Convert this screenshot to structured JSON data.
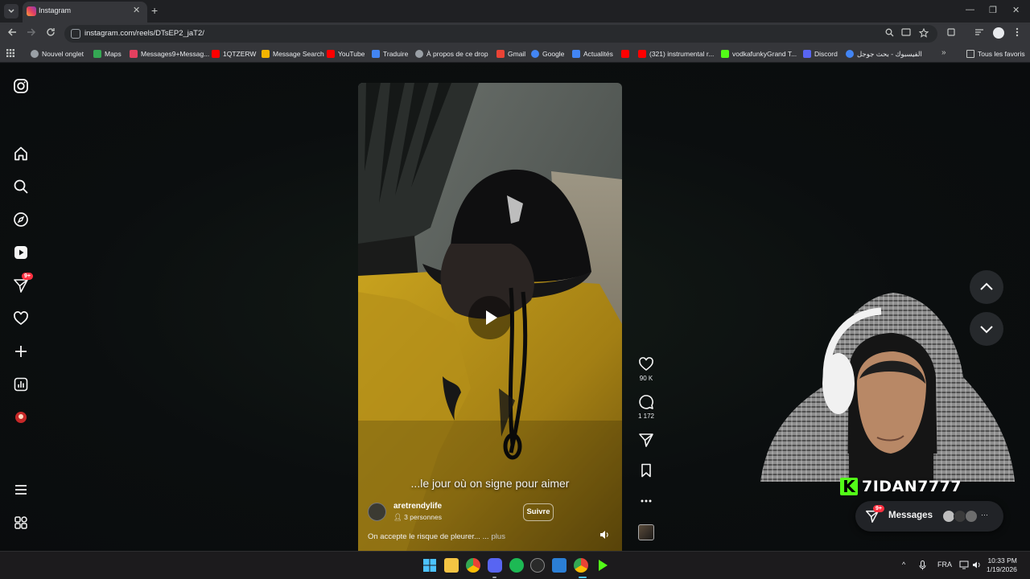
{
  "browser": {
    "tab_title": "Instagram",
    "tab_close": "✕",
    "new_tab": "+",
    "url": "instagram.com/reels/DTsEP2_jaT2/",
    "window_controls": [
      "—",
      "❐",
      "✕"
    ]
  },
  "bookmarks": {
    "items": [
      {
        "label": "Nouvel onglet",
        "icon": "globe-icon",
        "color": "#9aa0a6"
      },
      {
        "label": "Maps",
        "icon": "maps-icon",
        "color": "#34a853"
      },
      {
        "label": "Messages9+Messag...",
        "icon": "instagram-icon",
        "color": "#e4405f"
      },
      {
        "label": "1QTZERW",
        "icon": "youtube-icon",
        "color": "#ff0000"
      },
      {
        "label": "Message Search",
        "icon": "chart-icon",
        "color": "#f4b400"
      },
      {
        "label": "YouTube",
        "icon": "youtube-icon",
        "color": "#ff0000"
      },
      {
        "label": "Traduire",
        "icon": "translate-icon",
        "color": "#4285f4"
      },
      {
        "label": "À propos de ce drop",
        "icon": "globe-icon",
        "color": "#9aa0a6"
      },
      {
        "label": "Gmail",
        "icon": "gmail-icon",
        "color": "#ea4335"
      },
      {
        "label": "Google",
        "icon": "google-icon",
        "color": "#4285f4"
      },
      {
        "label": "Actualités",
        "icon": "news-icon",
        "color": "#4285f4"
      },
      {
        "label": "",
        "icon": "youtube-icon",
        "color": "#ff0000"
      },
      {
        "label": "(321) instrumental r...",
        "icon": "youtube-icon",
        "color": "#ff0000"
      },
      {
        "label": "vodkafunkyGrand T...",
        "icon": "kick-icon",
        "color": "#53fc18"
      },
      {
        "label": "Discord",
        "icon": "discord-icon",
        "color": "#5865f2"
      },
      {
        "label": "الفيسبوك - بحث جوجل",
        "icon": "google-icon",
        "color": "#4285f4"
      }
    ],
    "more": "»",
    "all_favorites": "Tous les favoris"
  },
  "reel": {
    "overlay_text": "...le jour où on signe pour aimer",
    "author": "aretrendylife",
    "audience": "3 personnes",
    "follow_label": "Suivre",
    "description": "On accepte le risque de pleurer... ...",
    "more_label": "plus"
  },
  "actions": {
    "likes": "90 K",
    "comments": "1 172"
  },
  "sidebar": {
    "notification_badge": "9+"
  },
  "overlay": {
    "streamer_name": "7IDAN7777",
    "kick_letter": "K"
  },
  "messages": {
    "label": "Messages",
    "badge": "9+",
    "more": "···"
  },
  "taskbar": {
    "language": "FRA",
    "time": "10:33 PM",
    "date": "1/19/2026",
    "chevron": "^"
  },
  "colors": {
    "accent_badge": "#ff3040",
    "kick_green": "#53fc18"
  }
}
